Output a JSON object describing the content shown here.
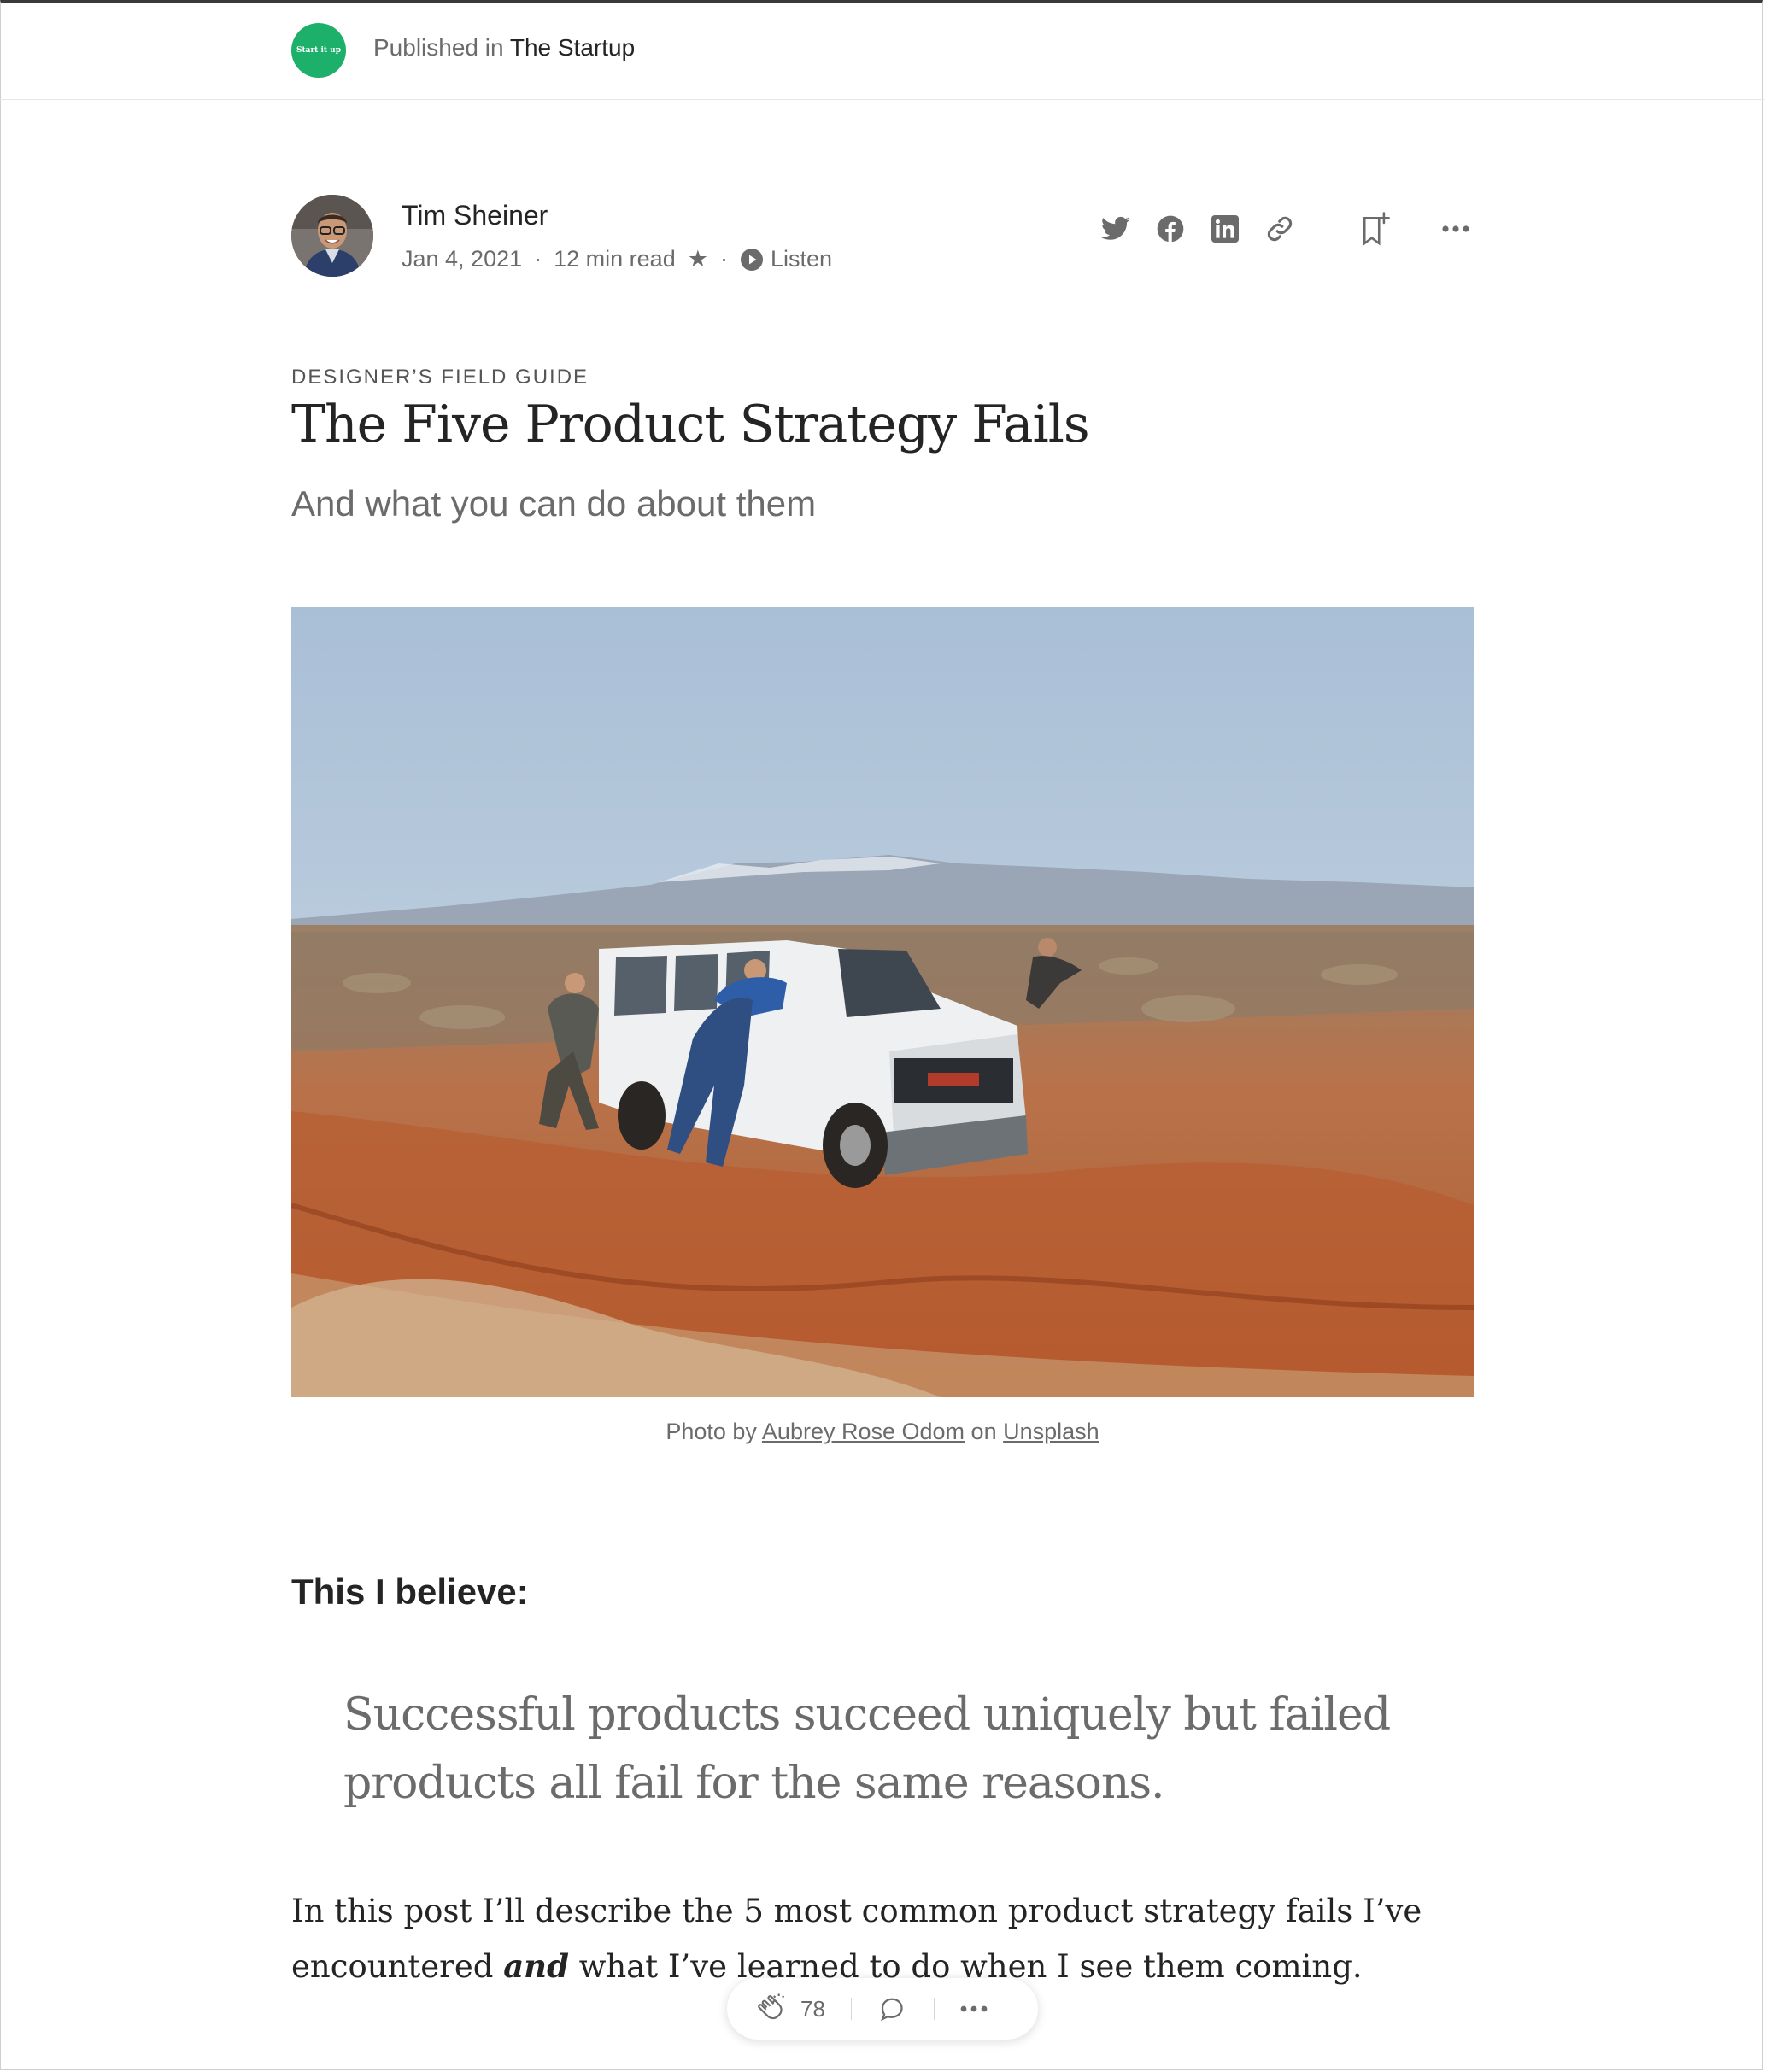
{
  "publication": {
    "logo_text": "Start it up",
    "prefix": "Published in",
    "name": "The Startup"
  },
  "author": {
    "name": "Tim Sheiner",
    "date": "Jan 4, 2021",
    "read_time": "12 min read",
    "member_star": "★",
    "listen_label": "Listen"
  },
  "share_icons": [
    "twitter-icon",
    "facebook-icon",
    "linkedin-icon",
    "link-icon"
  ],
  "article": {
    "kicker": "DESIGNER’S FIELD GUIDE",
    "title": "The Five Product Strategy Fails",
    "subtitle": "And what you can do about them",
    "caption_prefix": "Photo by",
    "caption_author": "Aubrey Rose Odom",
    "caption_mid": "on",
    "caption_source": "Unsplash",
    "heading": "This I believe:",
    "quote": "Successful products succeed uniquely but failed products all fail for the same reasons.",
    "para_start": "In this post I’ll describe the 5 most common product strategy fails I’ve encountered",
    "para_emph": "and",
    "para_end": "what I’ve learned to do when I see them coming."
  },
  "actions": {
    "clap_count": "78"
  },
  "colors": {
    "publication_green": "#1db06a",
    "text_primary": "#242424",
    "text_secondary": "#6b6b6b"
  }
}
